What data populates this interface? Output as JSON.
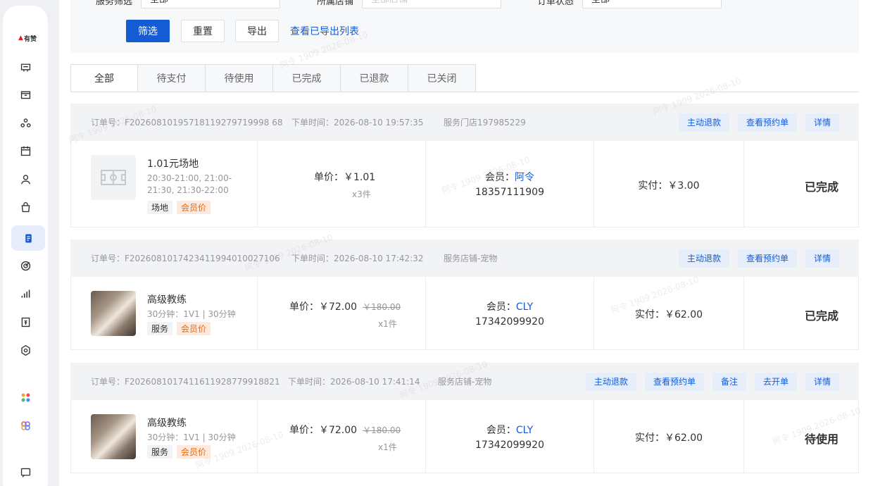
{
  "brand": {
    "logo_text": "有赞"
  },
  "filter": {
    "field1": {
      "label": "服务筛选",
      "value": "全部"
    },
    "field2": {
      "label": "所属店铺",
      "value": "全部店铺"
    },
    "field3": {
      "label": "订单状态",
      "value": "全部"
    },
    "filter_btn": "筛选",
    "reset_btn": "重置",
    "export_btn": "导出",
    "export_list_link": "查看已导出列表"
  },
  "tabs": [
    {
      "label": "全部",
      "active": true
    },
    {
      "label": "待支付"
    },
    {
      "label": "待使用"
    },
    {
      "label": "已完成"
    },
    {
      "label": "已退款"
    },
    {
      "label": "已关闭"
    }
  ],
  "orders": [
    {
      "order_no": "订单号：F20260810195718119279719998 68",
      "time": "下单时间：2026-08-10 19:57:35",
      "store": "服务门店197985229",
      "actions": [
        "主动退款",
        "查看预约单",
        "详情"
      ],
      "title": "1.01元场地",
      "desc": "20:30-21:00, 21:00-21:30, 21:30-22:00",
      "tags": [
        "场地",
        "会员价"
      ],
      "price": "单价：￥1.01",
      "price_strike": "",
      "qty": "x3件",
      "member_label": "会员：",
      "member_name": "阿令",
      "phone": "18357111909",
      "paid": "实付：￥3.00",
      "status": "已完成"
    },
    {
      "order_no": "订单号：F2026081017423411994010027106",
      "time": "下单时间：2026-08-10 17:42:32",
      "store": "服务店铺-宠物",
      "actions": [
        "主动退款",
        "查看预约单",
        "详情"
      ],
      "title": "高级教练",
      "desc": "30分钟：1V1 | 30分钟",
      "tags": [
        "服务",
        "会员价"
      ],
      "price": "单价：￥72.00",
      "price_strike": "￥180.00",
      "qty": "x1件",
      "member_label": "会员：",
      "member_name": "CLY",
      "phone": "17342099920",
      "paid": "实付：￥62.00",
      "status": "已完成"
    },
    {
      "order_no": "订单号：F2026081017411611928779918821",
      "time": "下单时间：2026-08-10 17:41:14",
      "store": "服务店铺-宠物",
      "actions": [
        "主动退款",
        "查看预约单",
        "备注",
        "去开单",
        "详情"
      ],
      "title": "高级教练",
      "desc": "30分钟：1V1 | 30分钟",
      "tags": [
        "服务",
        "会员价"
      ],
      "price": "单价：￥72.00",
      "price_strike": "￥180.00",
      "qty": "x1件",
      "member_label": "会员：",
      "member_name": "CLY",
      "phone": "17342099920",
      "paid": "实付：￥62.00",
      "status": "待使用"
    }
  ],
  "watermark": "阿令 1909 2026-08-10"
}
